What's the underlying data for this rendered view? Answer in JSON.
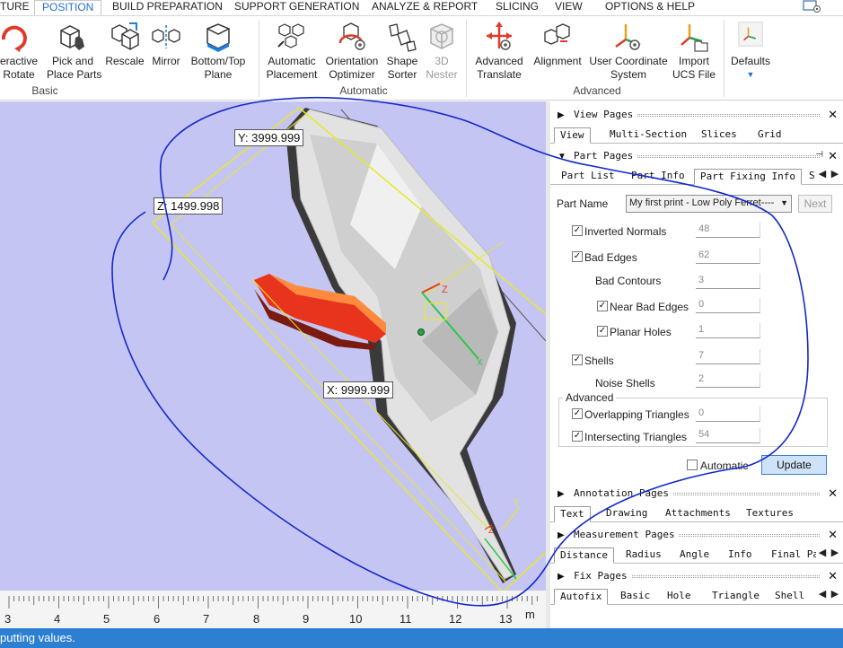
{
  "ribbon_tabs": [
    "TURE",
    "POSITION",
    "BUILD PREPARATION",
    "SUPPORT GENERATION",
    "ANALYZE & REPORT",
    "SLICING",
    "VIEW",
    "OPTIONS & HELP"
  ],
  "active_tab": "POSITION",
  "ribbon": {
    "buttons": [
      {
        "line1": "eractive",
        "line2": "Rotate",
        "icon": "rotate-icon"
      },
      {
        "line1": "Pick and",
        "line2": "Place Parts",
        "icon": "pick-place-icon"
      },
      {
        "line1": "Rescale",
        "line2": "",
        "icon": "rescale-icon"
      },
      {
        "line1": "Mirror",
        "line2": "",
        "icon": "mirror-icon"
      },
      {
        "line1": "Bottom/Top",
        "line2": "Plane",
        "icon": "bottom-top-plane-icon"
      },
      {
        "line1": "Automatic",
        "line2": "Placement",
        "icon": "automatic-placement-icon"
      },
      {
        "line1": "Orientation",
        "line2": "Optimizer",
        "icon": "orientation-optimizer-icon"
      },
      {
        "line1": "Shape",
        "line2": "Sorter",
        "icon": "shape-sorter-icon"
      },
      {
        "line1": "3D",
        "line2": "Nester",
        "icon": "nester-icon"
      },
      {
        "line1": "Advanced",
        "line2": "Translate",
        "icon": "advanced-translate-icon"
      },
      {
        "line1": "Alignment",
        "line2": "",
        "icon": "alignment-icon"
      },
      {
        "line1": "User Coordinate",
        "line2": "System",
        "icon": "ucs-icon"
      },
      {
        "line1": "Import",
        "line2": "UCS File",
        "icon": "import-ucs-icon"
      },
      {
        "line1": "Defaults",
        "line2": "",
        "icon": "defaults-icon"
      }
    ],
    "groups": {
      "basic": "Basic",
      "automatic": "Automatic",
      "advanced": "Advanced"
    }
  },
  "viewport": {
    "dim_y": "Y: 3999.999",
    "dim_z": "Z: 1499.998",
    "dim_x": "X: 9999.999",
    "axis_z": "Z",
    "axis_x": "X",
    "axis_y": "Y",
    "colors": {
      "background": "#c5c5f4",
      "bbox": "#e8e82a",
      "part": "#e0e0e0",
      "defect": "#e8341c"
    }
  },
  "ruler": {
    "ticks": [
      "3",
      "4",
      "5",
      "6",
      "7",
      "8",
      "9",
      "10",
      "11",
      "12",
      "13"
    ],
    "unit": "m"
  },
  "panel": {
    "view_pages": {
      "title": "View Pages",
      "tabs": [
        "View",
        "Multi-Section",
        "Slices",
        "Grid"
      ]
    },
    "part_pages": {
      "title": "Part Pages",
      "tabs": [
        "Part List",
        "Part Info",
        "Part Fixing Info",
        "S"
      ]
    },
    "part_name_label": "Part Name",
    "part_name_value": "My first print - Low Poly Ferret----",
    "next_label": "Next",
    "fields": {
      "inverted_normals": {
        "label": "Inverted Normals",
        "value": "48"
      },
      "bad_edges": {
        "label": "Bad Edges",
        "value": "62"
      },
      "bad_contours": {
        "label": "Bad Contours",
        "value": "3"
      },
      "near_bad_edges": {
        "label": "Near Bad Edges",
        "value": "0"
      },
      "planar_holes": {
        "label": "Planar Holes",
        "value": "1"
      },
      "shells": {
        "label": "Shells",
        "value": "7"
      },
      "noise_shells": {
        "label": "Noise Shells",
        "value": "2"
      },
      "overlapping_triangles": {
        "label": "Overlapping Triangles",
        "value": "0"
      },
      "intersecting_triangles": {
        "label": "Intersecting Triangles",
        "value": "54"
      }
    },
    "advanced_label": "Advanced",
    "automatic_label": "Automatic",
    "update_label": "Update",
    "annotation_pages": {
      "title": "Annotation Pages",
      "tabs": [
        "Text",
        "Drawing",
        "Attachments",
        "Textures"
      ]
    },
    "measurement_pages": {
      "title": "Measurement Pages",
      "tabs": [
        "Distance",
        "Radius",
        "Angle",
        "Info",
        "Final Pa"
      ]
    },
    "fix_pages": {
      "title": "Fix Pages",
      "tabs": [
        "Autofix",
        "Basic",
        "Hole",
        "Triangle",
        "Shell"
      ]
    }
  },
  "status_text": "putting values."
}
